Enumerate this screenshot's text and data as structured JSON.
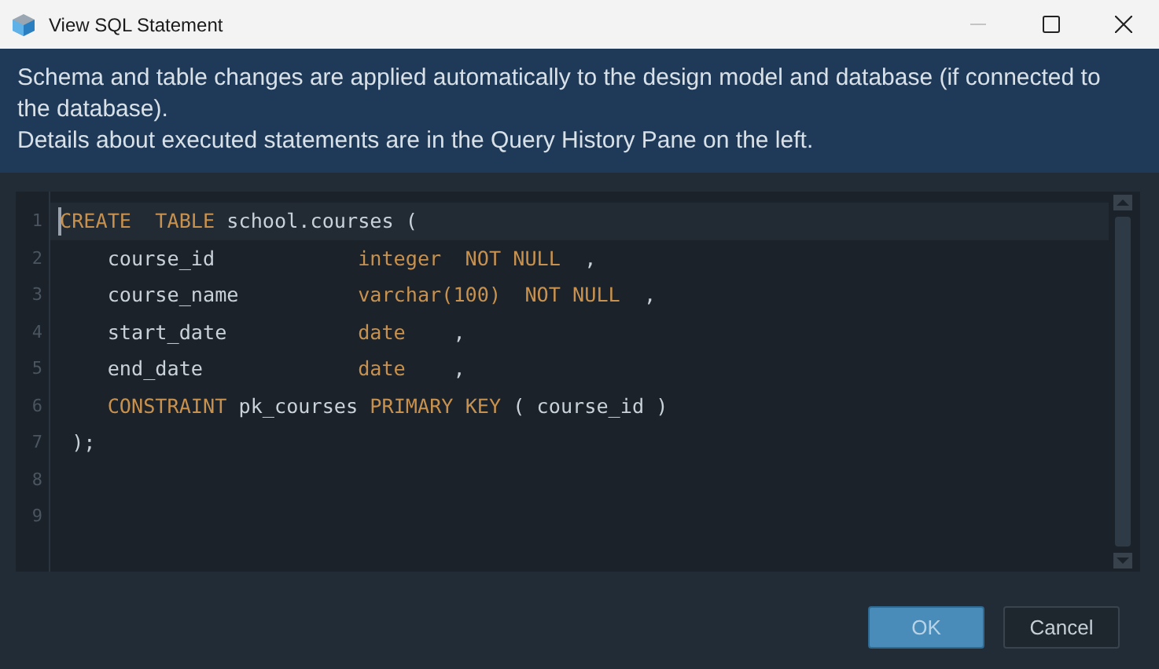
{
  "window": {
    "title": "View SQL Statement"
  },
  "banner": [
    "Schema and table changes are applied automatically to the design model and database (if connected to the database).",
    "Details about executed statements are in the Query History Pane on the left."
  ],
  "editor": {
    "lines": [
      {
        "number": "1",
        "current": true,
        "tokens": [
          {
            "text": "CREATE  TABLE",
            "kind": "keyword"
          },
          {
            "text": " school.courses (",
            "kind": "plain"
          }
        ]
      },
      {
        "number": "2",
        "current": false,
        "tokens": [
          {
            "text": "    course_id            ",
            "kind": "plain"
          },
          {
            "text": "integer  NOT NULL",
            "kind": "keyword"
          },
          {
            "text": "  ,",
            "kind": "plain"
          }
        ]
      },
      {
        "number": "3",
        "current": false,
        "tokens": [
          {
            "text": "    course_name          ",
            "kind": "plain"
          },
          {
            "text": "varchar(100)  NOT NULL",
            "kind": "keyword"
          },
          {
            "text": "  ,",
            "kind": "plain"
          }
        ]
      },
      {
        "number": "4",
        "current": false,
        "tokens": [
          {
            "text": "    start_date           ",
            "kind": "plain"
          },
          {
            "text": "date",
            "kind": "keyword"
          },
          {
            "text": "    ,",
            "kind": "plain"
          }
        ]
      },
      {
        "number": "5",
        "current": false,
        "tokens": [
          {
            "text": "    end_date             ",
            "kind": "plain"
          },
          {
            "text": "date",
            "kind": "keyword"
          },
          {
            "text": "    ,",
            "kind": "plain"
          }
        ]
      },
      {
        "number": "6",
        "current": false,
        "tokens": [
          {
            "text": "    CONSTRAINT",
            "kind": "keyword"
          },
          {
            "text": " pk_courses ",
            "kind": "plain"
          },
          {
            "text": "PRIMARY KEY",
            "kind": "keyword"
          },
          {
            "text": " ( course_id )",
            "kind": "plain"
          }
        ]
      },
      {
        "number": "7",
        "current": false,
        "tokens": [
          {
            "text": " );",
            "kind": "plain"
          }
        ]
      },
      {
        "number": "8",
        "current": false
      },
      {
        "number": "9",
        "current": false
      }
    ]
  },
  "buttons": [
    {
      "label": "OK",
      "selected": true
    },
    {
      "label": "Cancel",
      "selected": false
    }
  ]
}
